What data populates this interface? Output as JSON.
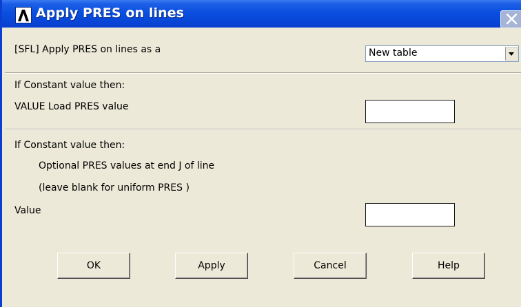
{
  "window": {
    "title": "Apply PRES on lines"
  },
  "row_apply_as": {
    "label": "[SFL] Apply PRES on lines as a",
    "selected": "New table"
  },
  "section1": {
    "heading": "If Constant value then:",
    "value_label": "VALUE  Load PRES value",
    "value": ""
  },
  "section2": {
    "heading": "If Constant value then:",
    "note1": "Optional PRES values at end J of line",
    "note2": "(leave blank for uniform PRES )",
    "value_label": "Value",
    "value": ""
  },
  "buttons": {
    "ok": "OK",
    "apply": "Apply",
    "cancel": "Cancel",
    "help": "Help"
  },
  "icons": {
    "title": "ansys-logo-icon",
    "close": "close-icon",
    "dropdown": "chevron-down-icon"
  },
  "colors": {
    "titlebar": "#0a4fe0",
    "dialog_bg": "#ece9d8",
    "field_border": "#1a1a1a"
  }
}
